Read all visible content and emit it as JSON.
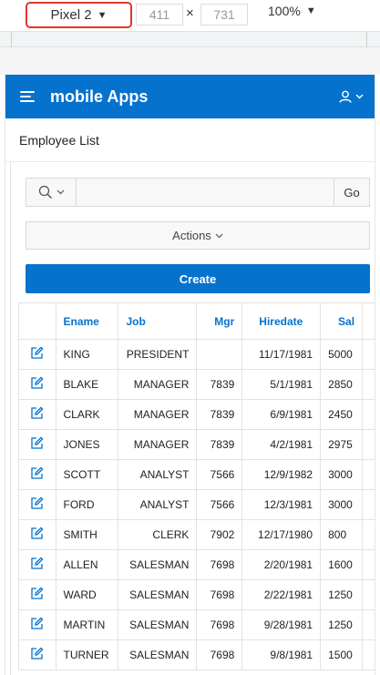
{
  "devtools": {
    "device": "Pixel 2",
    "width": "411",
    "x": "×",
    "height": "731",
    "zoom": "100%"
  },
  "app": {
    "title": "mobile Apps"
  },
  "region": {
    "title": "Employee List"
  },
  "toolbar": {
    "go_label": "Go",
    "actions_label": "Actions",
    "create_label": "Create"
  },
  "colors": {
    "primary": "#0572ce",
    "highlight": "#e3342f"
  },
  "table": {
    "columns": [
      "Ename",
      "Job",
      "Mgr",
      "Hiredate",
      "Sal"
    ],
    "rows": [
      [
        "KING",
        "PRESIDENT",
        "",
        "11/17/1981",
        "5000"
      ],
      [
        "BLAKE",
        "MANAGER",
        "7839",
        "5/1/1981",
        "2850"
      ],
      [
        "CLARK",
        "MANAGER",
        "7839",
        "6/9/1981",
        "2450"
      ],
      [
        "JONES",
        "MANAGER",
        "7839",
        "4/2/1981",
        "2975"
      ],
      [
        "SCOTT",
        "ANALYST",
        "7566",
        "12/9/1982",
        "3000"
      ],
      [
        "FORD",
        "ANALYST",
        "7566",
        "12/3/1981",
        "3000"
      ],
      [
        "SMITH",
        "CLERK",
        "7902",
        "12/17/1980",
        "800"
      ],
      [
        "ALLEN",
        "SALESMAN",
        "7698",
        "2/20/1981",
        "1600"
      ],
      [
        "WARD",
        "SALESMAN",
        "7698",
        "2/22/1981",
        "1250"
      ],
      [
        "MARTIN",
        "SALESMAN",
        "7698",
        "9/28/1981",
        "1250"
      ],
      [
        "TURNER",
        "SALESMAN",
        "7698",
        "9/8/1981",
        "1500"
      ]
    ]
  }
}
